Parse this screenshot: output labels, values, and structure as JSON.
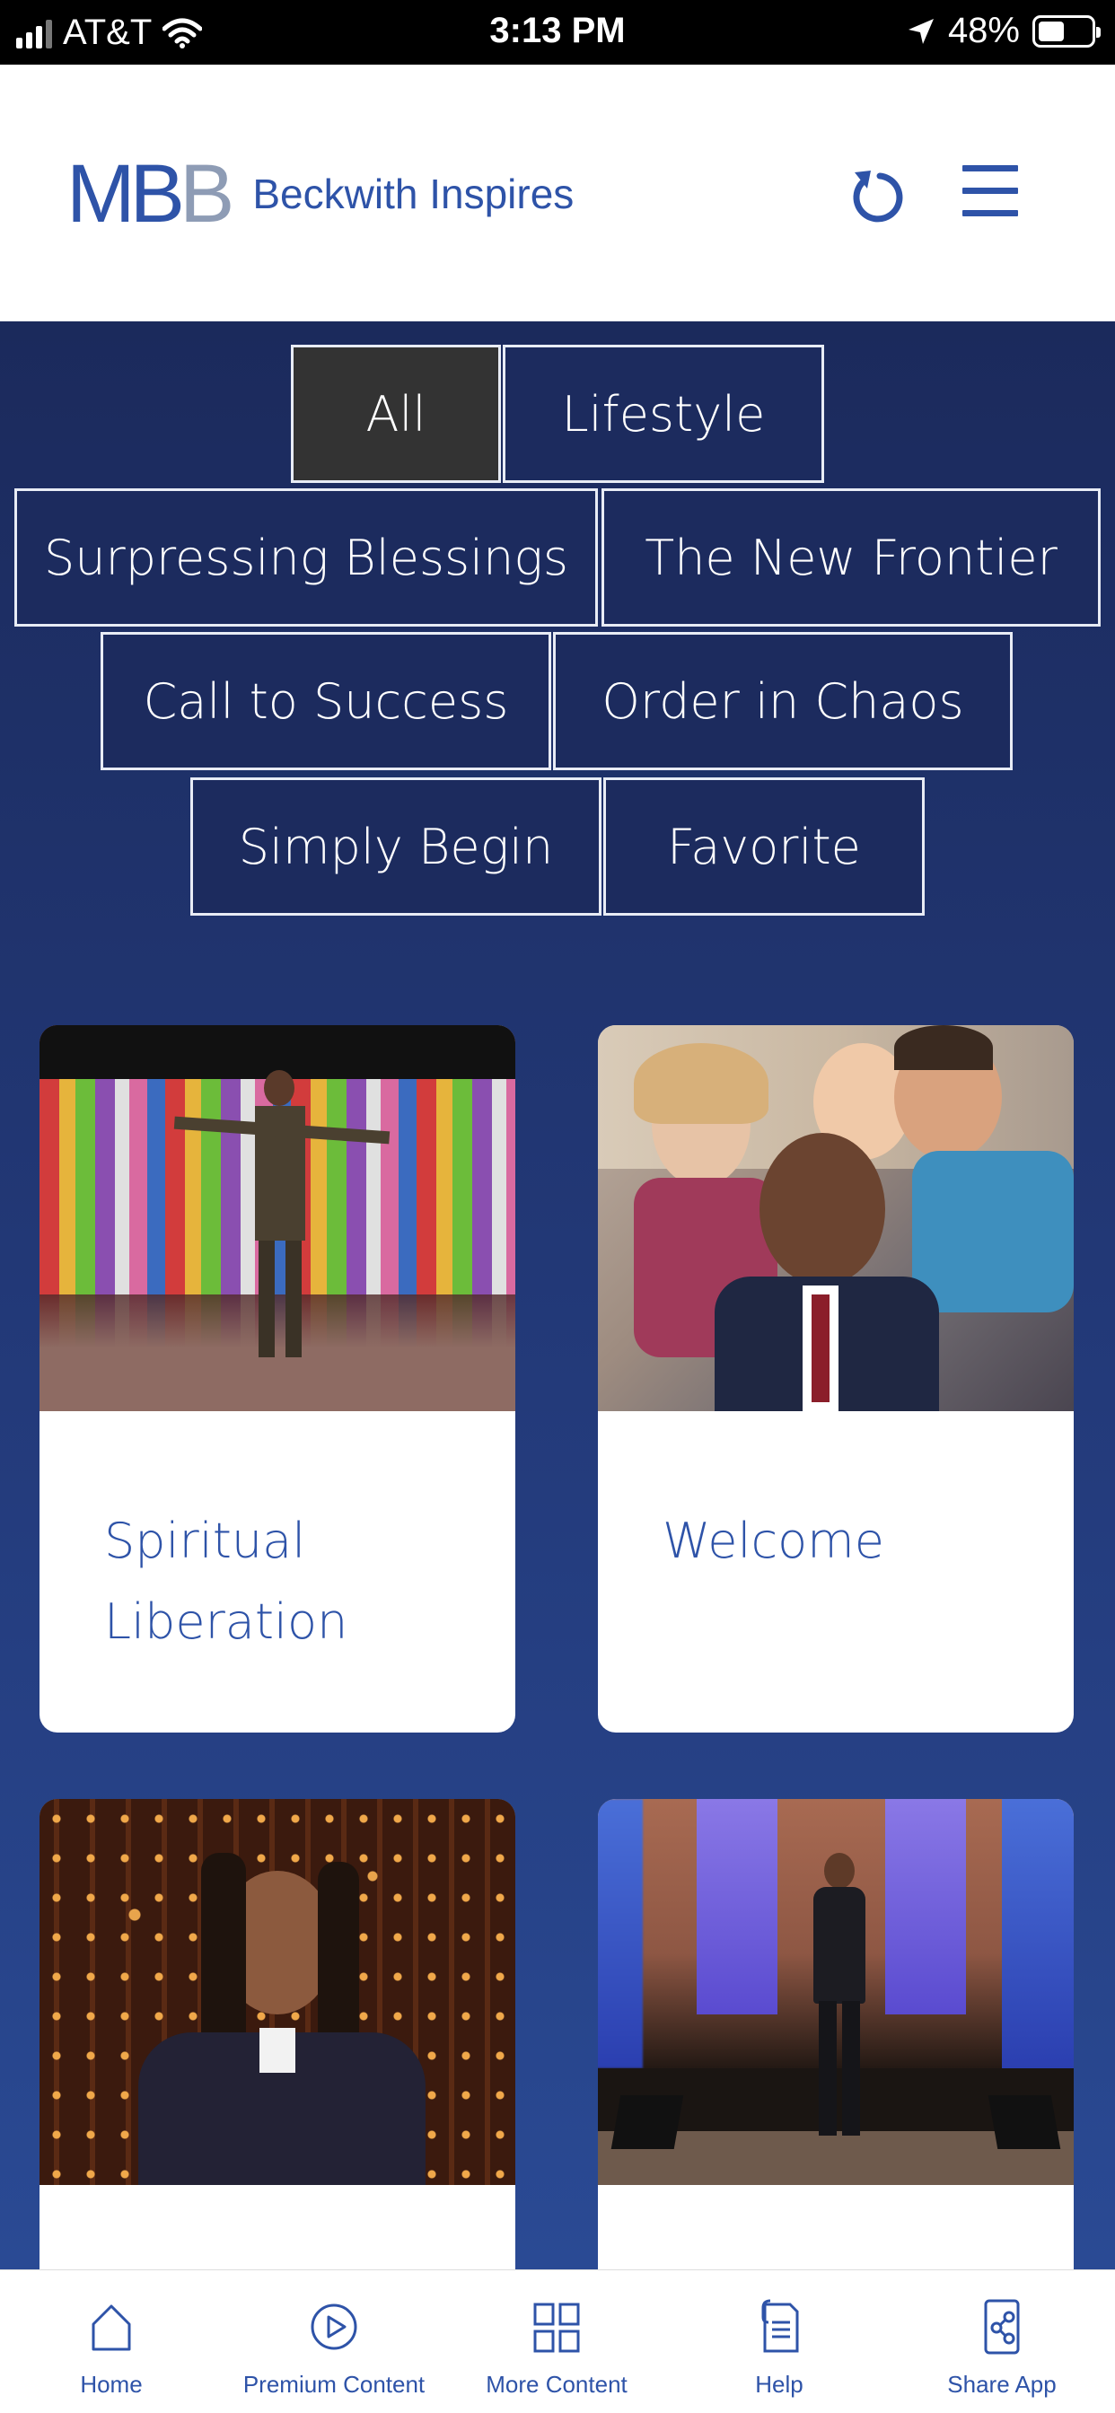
{
  "status_bar": {
    "carrier": "AT&T",
    "time": "3:13 PM",
    "battery": "48%",
    "battery_level": 0.48
  },
  "header": {
    "logo_mark_a": "MB",
    "logo_mark_b": "B",
    "logo_text": "Beckwith Inspires"
  },
  "filters": [
    {
      "label": "All",
      "active": true
    },
    {
      "label": "Lifestyle"
    },
    {
      "label": "Surpressing Blessings"
    },
    {
      "label": "The New Frontier"
    },
    {
      "label": "Call to Success"
    },
    {
      "label": "Order in Chaos"
    },
    {
      "label": "Simply Begin"
    },
    {
      "label": "Favorite"
    }
  ],
  "cards": [
    {
      "title_line1": "Spiritual",
      "title_line2": "Liberation"
    },
    {
      "title_line1": "Welcome",
      "title_line2": ""
    },
    {
      "title_line1": "",
      "title_line2": ""
    },
    {
      "title_line1": "",
      "title_line2": ""
    }
  ],
  "tabbar": [
    {
      "label": "Home",
      "icon": "home-icon"
    },
    {
      "label": "Premium Content",
      "icon": "play-icon"
    },
    {
      "label": "More Content",
      "icon": "grid-icon"
    },
    {
      "label": "Help",
      "icon": "help-document-icon"
    },
    {
      "label": "Share App",
      "icon": "share-icon"
    }
  ],
  "colors": {
    "brand_blue": "#2e53a8",
    "background": "#1f3168",
    "active_filter": "#333333"
  }
}
